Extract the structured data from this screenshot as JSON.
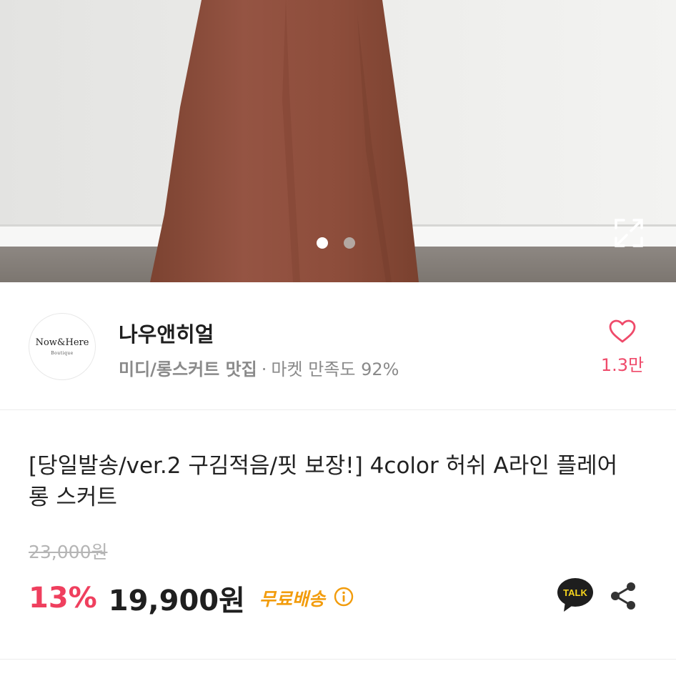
{
  "gallery": {
    "current_index": 1,
    "total": 2,
    "expand_icon": "expand-icon"
  },
  "store": {
    "logo_main": "Now&Here",
    "logo_sub": "Boutique",
    "name": "나우앤히얼",
    "tagline": "미디/롱스커트 맛집",
    "separator": "·",
    "satisfaction": "마켓 만족도 92%",
    "like_count": "1.3만",
    "like_color": "#ef4a6a"
  },
  "product": {
    "title": "[당일발송/ver.2 구김적음/핏 보장!] 4color 허쉬 A라인 플레어 롱 스커트",
    "original_price": "23,000원",
    "discount": "13%",
    "price": "19,900원",
    "shipping": "무료배송",
    "talk_label": "TALK",
    "discount_color": "#ef3f5e",
    "shipping_color": "#f29c0c"
  }
}
